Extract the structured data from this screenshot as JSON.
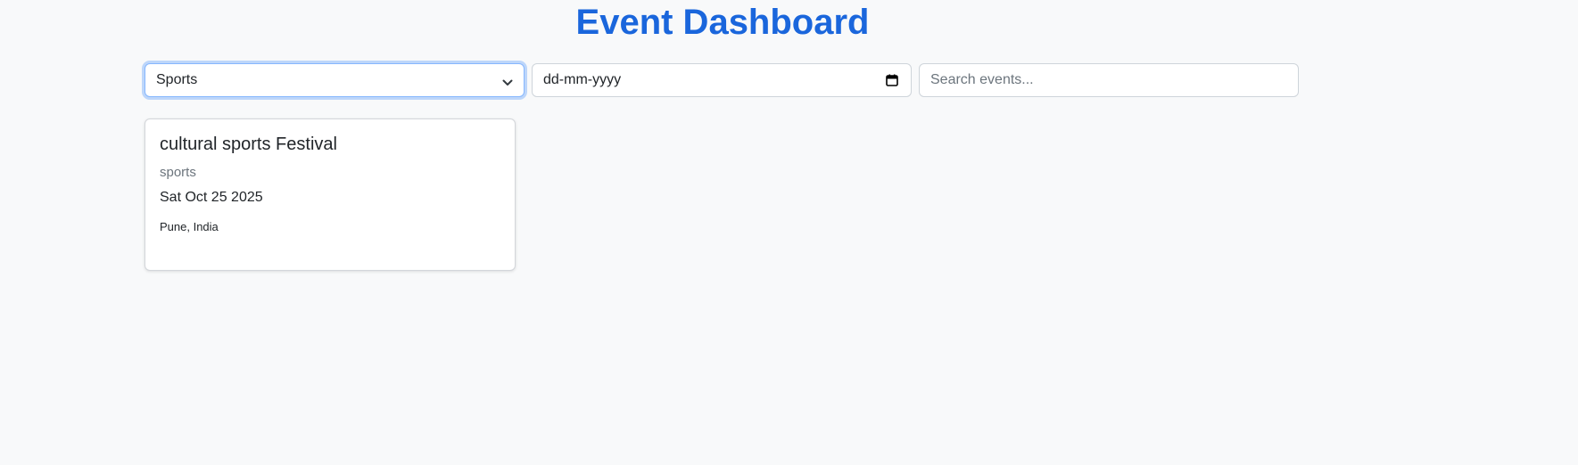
{
  "header": {
    "title": "Event Dashboard"
  },
  "filters": {
    "category": {
      "selected": "Sports"
    },
    "date": {
      "placeholder": "dd-mm-yyyy"
    },
    "search": {
      "placeholder": "Search events..."
    }
  },
  "events": [
    {
      "title": "cultural sports Festival",
      "category": "sports",
      "date": "Sat Oct 25 2025",
      "location": "Pune, India"
    }
  ],
  "colors": {
    "accent": "#1a66dc",
    "background": "#f8f9fa",
    "focus_ring": "#86b7fe"
  },
  "icons": [
    "chevron-down-icon",
    "calendar-icon"
  ]
}
